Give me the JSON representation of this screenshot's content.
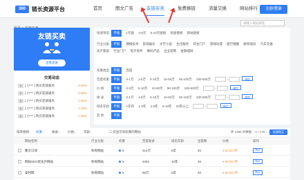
{
  "header": {
    "logo_mark": "360",
    "logo_text": "链长资源平台",
    "nav": [
      "首页",
      "图文广告",
      "友链买卖",
      "免费换链",
      "流量交换",
      "网站排行"
    ],
    "active_index": 2,
    "cta": "注册/登录"
  },
  "breadcrumb": "首页 > 友链买卖",
  "search": {
    "placeholder": "请输入网站域名"
  },
  "banner": {
    "title": "友链买卖",
    "button": "出售友链"
  },
  "ranking": {
    "title": "交易动态",
    "items": [
      {
        "rank": "1",
        "name": "[ 小*** ] 购买友链服务",
        "pct": "3.00%"
      },
      {
        "rank": "2",
        "name": "[ 小*** ] 购买友链服务",
        "pct": "2.00%"
      },
      {
        "rank": "3",
        "name": "[ 小*** ] 购买友链服务",
        "pct": "1.50%"
      },
      {
        "rank": "4",
        "name": "[ 小*** ] 购买友链服务",
        "pct": "1.20%"
      },
      {
        "rank": "5",
        "name": "[ 小*** ] 购买友链服务",
        "pct": "1.00%"
      }
    ]
  },
  "filters": {
    "quick": {
      "label": "快速筛选",
      "options": [
        "不限",
        "1元链",
        "3-5元",
        "5-10元链接",
        "优质链接",
        "新站链接"
      ]
    },
    "industry": {
      "label": "行业分类",
      "options": [
        "不限",
        "网络技术",
        "影视娱乐",
        "文学小说",
        "生活服务",
        "综合门户",
        "游戏动漫",
        "医疗健康",
        "教育培训",
        "汽车交通",
        "房产家居",
        "行业门户",
        "电子商务",
        "数码产品",
        "企业官网",
        "金融理财"
      ]
    },
    "weight_type": {
      "label": "权重类型",
      "options": [
        "不限",
        "百度"
      ]
    },
    "baidu_weight": {
      "label": "百度权重",
      "options": [
        "不限",
        "0-1万",
        "1-5万",
        "5-10万",
        "10-50万",
        "50-100万",
        "100-500万"
      ],
      "unit": "万",
      "ok": "确定"
    },
    "price": {
      "label": "价 格",
      "options": [
        "不限",
        "0-5元",
        "5-10元",
        "10-50元",
        "50-100元",
        "100-500元"
      ],
      "ok": "确定"
    },
    "income": {
      "label": "收 录",
      "options": [
        "不限",
        "0-1万",
        "1-5万",
        "5-10万",
        "10-50万",
        "50-100万",
        "100-500万"
      ],
      "ok": "确定"
    },
    "age": {
      "label": "域名年龄",
      "options": [
        "不限",
        "1年内",
        "1-2年",
        "2-5年",
        "5-10年",
        "10年以上"
      ],
      "ok": "确定"
    },
    "extra": {
      "label": "其 他",
      "options": [
        "不限"
      ]
    }
  },
  "toolbar": {
    "sort_label": "排序规则:",
    "sorts": [
      "权重↓",
      "收录↓",
      "价格↓",
      "年龄↓"
    ],
    "only_label": "仅显示有权重的网站",
    "summary": "共 1390 条数据",
    "pages": "1 / 175",
    "bulk": "批量购买"
  },
  "table": {
    "columns": [
      "网站名称",
      "行业分类",
      "权重",
      "百度收录",
      "域名年龄",
      "出链数",
      "价格",
      "操作"
    ],
    "rows": [
      {
        "name": "聚页订阅",
        "industry": "体育网站",
        "weight": "5",
        "index": "414万",
        "age": "5年",
        "links": "40",
        "price": "¥ 50.00 /月",
        "action": "购买"
      },
      {
        "name": "网站SEO优化外网站",
        "industry": "体育网站",
        "weight": "5",
        "index": "4262",
        "age": "10年",
        "links": "45",
        "price": "¥ 80.00 /月",
        "action": "购买"
      },
      {
        "name": "安利网",
        "industry": "体育网站",
        "weight": "5",
        "index": "68万",
        "age": "5年",
        "links": "40",
        "price": "¥ 90.00 /月",
        "action": "购买"
      }
    ]
  },
  "colors": {
    "accent": "#2f7df6",
    "price": "#f28c28",
    "annotation": "#e8332a"
  }
}
